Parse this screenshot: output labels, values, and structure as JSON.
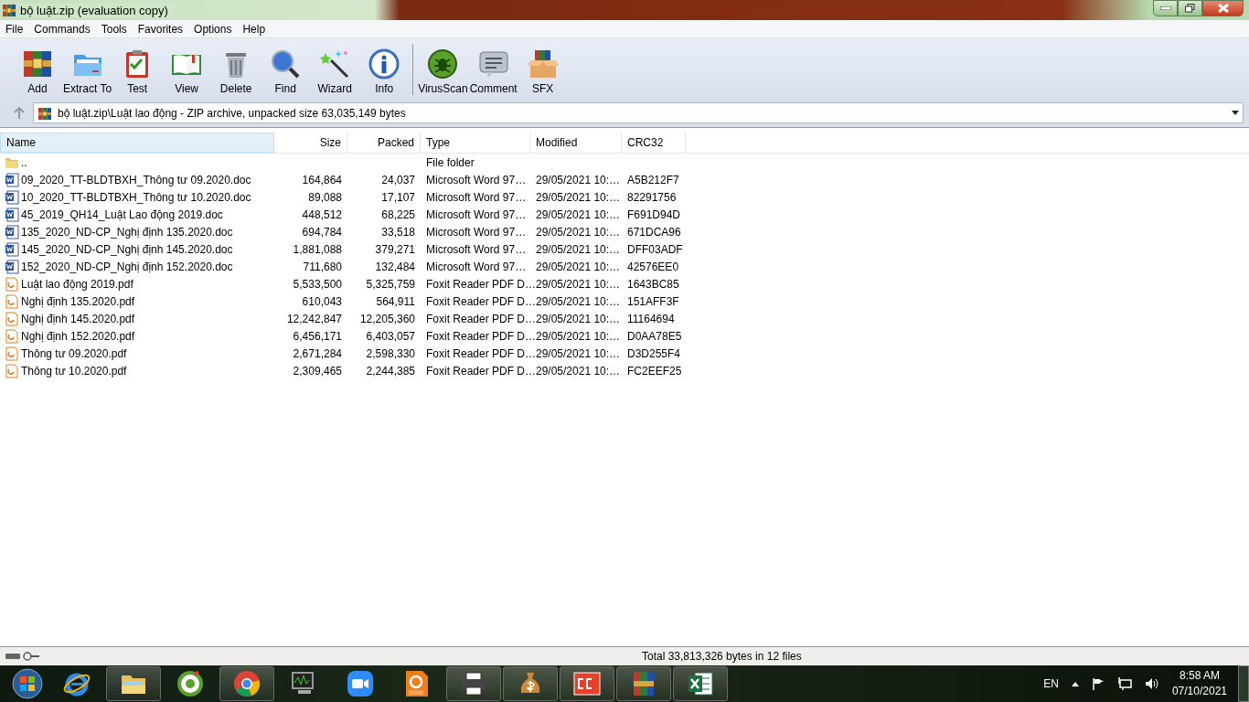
{
  "window": {
    "title": "bộ luật.zip (evaluation copy)"
  },
  "menu": [
    "File",
    "Commands",
    "Tools",
    "Favorites",
    "Options",
    "Help"
  ],
  "toolbar": [
    {
      "kind": "add",
      "label": "Add"
    },
    {
      "kind": "extract",
      "label": "Extract To"
    },
    {
      "kind": "test",
      "label": "Test"
    },
    {
      "kind": "view",
      "label": "View"
    },
    {
      "kind": "delete",
      "label": "Delete"
    },
    {
      "kind": "find",
      "label": "Find"
    },
    {
      "kind": "wizard",
      "label": "Wizard"
    },
    {
      "kind": "info",
      "label": "Info"
    },
    {
      "kind": "separator"
    },
    {
      "kind": "virus",
      "label": "VirusScan"
    },
    {
      "kind": "comment",
      "label": "Comment"
    },
    {
      "kind": "sfx",
      "label": "SFX"
    }
  ],
  "address": {
    "path": "bộ luật.zip\\Luật lao động - ZIP archive, unpacked size 63,035,149 bytes"
  },
  "table": {
    "columns": [
      "Name",
      "Size",
      "Packed",
      "Type",
      "Modified",
      "CRC32"
    ],
    "rows": [
      {
        "kind": "folder",
        "name": "..",
        "size": "",
        "packed": "",
        "type": "File folder",
        "modified": "",
        "crc": ""
      },
      {
        "kind": "doc",
        "name": "09_2020_TT-BLDTBXH_Thông tư 09.2020.doc",
        "size": "164,864",
        "packed": "24,037",
        "type": "Microsoft Word 97…",
        "modified": "29/05/2021 10:…",
        "crc": "A5B212F7"
      },
      {
        "kind": "doc",
        "name": "10_2020_TT-BLDTBXH_Thông tư 10.2020.doc",
        "size": "89,088",
        "packed": "17,107",
        "type": "Microsoft Word 97…",
        "modified": "29/05/2021 10:…",
        "crc": "82291756"
      },
      {
        "kind": "doc",
        "name": "45_2019_QH14_Luật Lao động 2019.doc",
        "size": "448,512",
        "packed": "68,225",
        "type": "Microsoft Word 97…",
        "modified": "29/05/2021 10:…",
        "crc": "F691D94D"
      },
      {
        "kind": "doc",
        "name": "135_2020_ND-CP_Nghị định 135.2020.doc",
        "size": "694,784",
        "packed": "33,518",
        "type": "Microsoft Word 97…",
        "modified": "29/05/2021 10:…",
        "crc": "671DCA96"
      },
      {
        "kind": "doc",
        "name": "145_2020_ND-CP_Nghị định 145.2020.doc",
        "size": "1,881,088",
        "packed": "379,271",
        "type": "Microsoft Word 97…",
        "modified": "29/05/2021 10:…",
        "crc": "DFF03ADF"
      },
      {
        "kind": "doc",
        "name": "152_2020_ND-CP_Nghị định 152.2020.doc",
        "size": "711,680",
        "packed": "132,484",
        "type": "Microsoft Word 97…",
        "modified": "29/05/2021 10:…",
        "crc": "42576EE0"
      },
      {
        "kind": "pdf",
        "name": "Luật lao động 2019.pdf",
        "size": "5,533,500",
        "packed": "5,325,759",
        "type": "Foxit Reader PDF D…",
        "modified": "29/05/2021 10:…",
        "crc": "1643BC85"
      },
      {
        "kind": "pdf",
        "name": "Nghị định 135.2020.pdf",
        "size": "610,043",
        "packed": "564,911",
        "type": "Foxit Reader PDF D…",
        "modified": "29/05/2021 10:…",
        "crc": "151AFF3F"
      },
      {
        "kind": "pdf",
        "name": "Nghị định 145.2020.pdf",
        "size": "12,242,847",
        "packed": "12,205,360",
        "type": "Foxit Reader PDF D…",
        "modified": "29/05/2021 10:…",
        "crc": "11164694"
      },
      {
        "kind": "pdf",
        "name": "Nghị định 152.2020.pdf",
        "size": "6,456,171",
        "packed": "6,403,057",
        "type": "Foxit Reader PDF D…",
        "modified": "29/05/2021 10:…",
        "crc": "D0AA78E5"
      },
      {
        "kind": "pdf",
        "name": "Thông tư 09.2020.pdf",
        "size": "2,671,284",
        "packed": "2,598,330",
        "type": "Foxit Reader PDF D…",
        "modified": "29/05/2021 10:…",
        "crc": "D3D255F4"
      },
      {
        "kind": "pdf",
        "name": "Thông tư 10.2020.pdf",
        "size": "2,309,465",
        "packed": "2,244,385",
        "type": "Foxit Reader PDF D…",
        "modified": "29/05/2021 10:…",
        "crc": "FC2EEF25"
      }
    ]
  },
  "status_bar": {
    "total": "Total 33,813,326 bytes in 12 files"
  },
  "taskbar": {
    "apps": [
      {
        "kind": "ie",
        "running": false
      },
      {
        "kind": "explorer",
        "running": true
      },
      {
        "kind": "ccleaner",
        "running": false
      },
      {
        "kind": "chrome",
        "running": true
      },
      {
        "kind": "monitor",
        "running": false
      },
      {
        "kind": "zoom",
        "running": false
      },
      {
        "kind": "foxit",
        "running": false
      },
      {
        "kind": "printer",
        "running": true
      },
      {
        "kind": "money",
        "running": true
      },
      {
        "kind": "cc4",
        "running": true
      },
      {
        "kind": "winrar",
        "running": true
      },
      {
        "kind": "excel",
        "running": true
      }
    ],
    "language": "EN",
    "time": "8:58 AM",
    "date": "07/10/2021"
  }
}
